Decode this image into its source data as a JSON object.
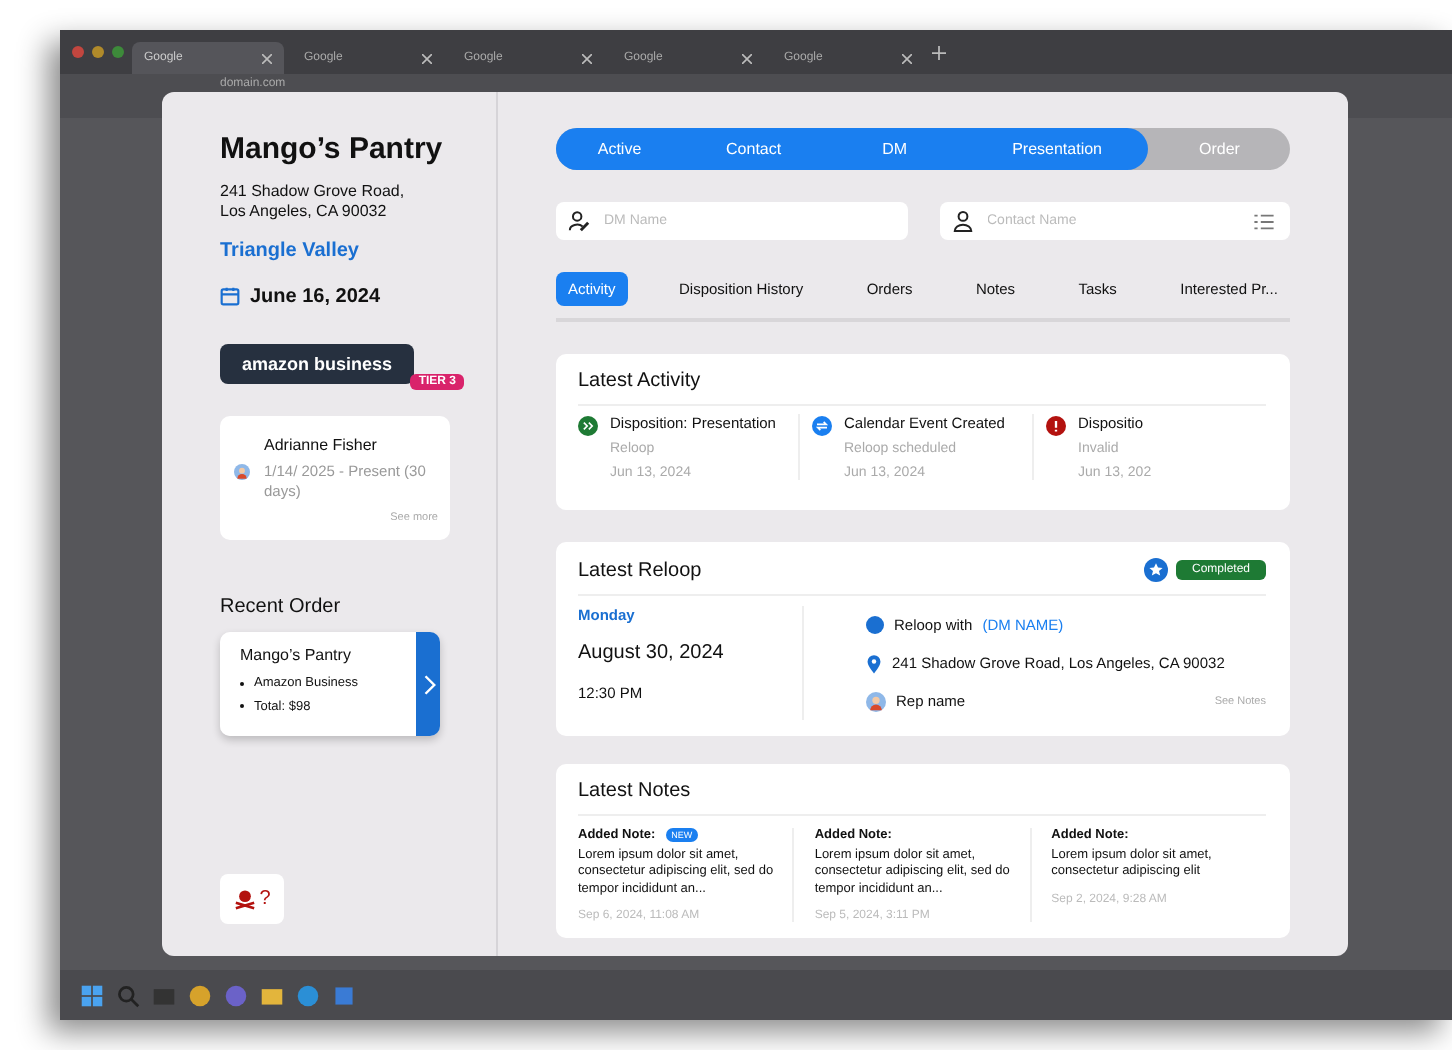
{
  "browser": {
    "tabs": [
      {
        "title": "Google",
        "selected": true
      },
      {
        "title": "Google",
        "selected": false
      },
      {
        "title": "Google",
        "selected": false
      },
      {
        "title": "Google",
        "selected": false
      },
      {
        "title": "Google",
        "selected": false
      }
    ],
    "address": "domain.com"
  },
  "sidebar": {
    "name": "Mango’s Pantry",
    "address_lines": [
      "241 Shadow Grove Road,",
      "Los Angeles, CA 90032"
    ],
    "area": "Triangle Valley",
    "date": "June 16, 2024",
    "partner": "amazon business",
    "tier": "TIER 3",
    "rep": {
      "name": "Adrianne Fisher",
      "period": "1/14/ 2025 - Present (30 days)",
      "link": "See more"
    },
    "recent_order": {
      "heading": "Recent Order",
      "name": "Mango’s Pantry",
      "lines": [
        "Amazon Business",
        "Total: $98"
      ]
    },
    "flag_label": "?"
  },
  "pipeline": [
    {
      "label": "Active",
      "reached": true
    },
    {
      "label": "Contact",
      "reached": true
    },
    {
      "label": "DM",
      "reached": true
    },
    {
      "label": "Presentation",
      "reached": true
    },
    {
      "label": "Order",
      "reached": false
    }
  ],
  "fields": [
    {
      "kind": "dm",
      "placeholder": "DM Name"
    },
    {
      "kind": "contact",
      "placeholder": "Contact Name"
    }
  ],
  "tabs": [
    {
      "label": "Activity",
      "selected": true
    },
    {
      "label": "Disposition History",
      "selected": false
    },
    {
      "label": "Orders",
      "selected": false
    },
    {
      "label": "Notes",
      "selected": false
    },
    {
      "label": "Tasks",
      "selected": false
    },
    {
      "label": "Interested Pr...",
      "selected": false
    }
  ],
  "activity": {
    "title": "Latest Activity",
    "items": [
      {
        "kind": "forward",
        "color": "#1e7a34",
        "title": "Disposition: Presentation",
        "subtitle": "Reloop",
        "date": "Jun 13, 2024"
      },
      {
        "kind": "repeat",
        "color": "#1a7ff0",
        "title": "Calendar Event Created",
        "subtitle": "Reloop scheduled",
        "date": "Jun 13, 2024"
      },
      {
        "kind": "alert",
        "color": "#b3120f",
        "title": "Dispositio",
        "subtitle": "Invalid",
        "date": "Jun 13, 202"
      }
    ]
  },
  "reloop": {
    "title": "Latest Reloop",
    "status": "Completed",
    "day": "Monday",
    "date": "August 30, 2024",
    "time": "12:30 PM",
    "with_label": "Reloop with",
    "dm": "(DM NAME)",
    "address": "241 Shadow Grove Road, Los Angeles, CA 90032",
    "rep": "Rep name",
    "link": "See Notes"
  },
  "notes": {
    "title": "Latest Notes",
    "items": [
      {
        "label": "Added Note:",
        "new": true,
        "badge": "NEW",
        "text": "Lorem ipsum dolor sit amet, consectetur adipiscing elit, sed do tempor incididunt an...",
        "date": "Sep 6, 2024, 11:08 AM"
      },
      {
        "label": "Added Note:",
        "new": false,
        "text": "Lorem ipsum dolor sit amet, consectetur adipiscing elit, sed do tempor incididunt an...",
        "date": "Sep 5, 2024, 3:11 PM"
      },
      {
        "label": "Added Note:",
        "new": false,
        "text": "Lorem ipsum dolor sit amet, consectetur adipiscing elit",
        "date": "Sep 2, 2024, 9:28 AM"
      }
    ]
  }
}
